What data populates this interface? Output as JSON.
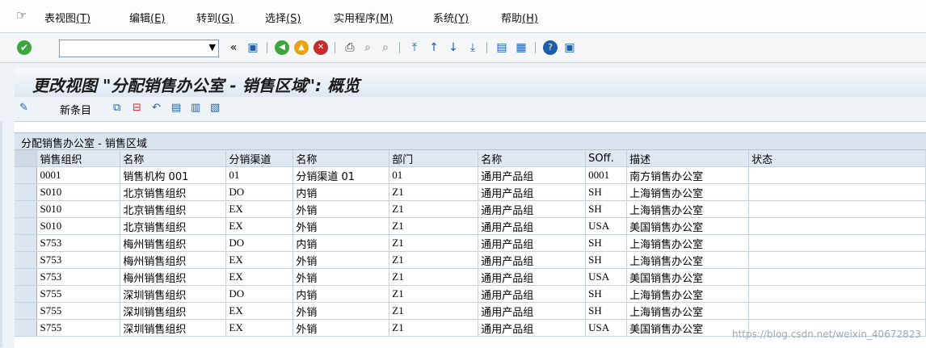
{
  "menubar": {
    "items": [
      {
        "label": "表视图",
        "acc": "(T)"
      },
      {
        "label": "编辑",
        "acc": "(E)"
      },
      {
        "label": "转到",
        "acc": "(G)"
      },
      {
        "label": "选择",
        "acc": "(S)"
      },
      {
        "label": "实用程序",
        "acc": "(M)"
      },
      {
        "label": "系统",
        "acc": "(Y)"
      },
      {
        "label": "帮助",
        "acc": "(H)"
      }
    ]
  },
  "toolbar": {
    "command_value": ""
  },
  "header": {
    "title": "更改视图 \"分配销售办公室 - 销售区域\": 概览"
  },
  "apptoolbar": {
    "new_entries": "新条目"
  },
  "table": {
    "title": "分配销售办公室 - 销售区域",
    "columns": [
      "销售组织",
      "名称",
      "分销渠道",
      "名称",
      "部门",
      "名称",
      "SOff.",
      "描述",
      "状态"
    ],
    "rows": [
      [
        "0001",
        "销售机构 001",
        "01",
        "分销渠道 01",
        "01",
        "通用产品组",
        "0001",
        "南方销售办公室",
        ""
      ],
      [
        "S010",
        "北京销售组织",
        "DO",
        "内销",
        "Z1",
        "通用产品组",
        "SH",
        "上海销售办公室",
        ""
      ],
      [
        "S010",
        "北京销售组织",
        "EX",
        "外销",
        "Z1",
        "通用产品组",
        "SH",
        "上海销售办公室",
        ""
      ],
      [
        "S010",
        "北京销售组织",
        "EX",
        "外销",
        "Z1",
        "通用产品组",
        "USA",
        "美国销售办公室",
        ""
      ],
      [
        "S753",
        "梅州销售组织",
        "DO",
        "内销",
        "Z1",
        "通用产品组",
        "SH",
        "上海销售办公室",
        ""
      ],
      [
        "S753",
        "梅州销售组织",
        "EX",
        "外销",
        "Z1",
        "通用产品组",
        "SH",
        "上海销售办公室",
        ""
      ],
      [
        "S753",
        "梅州销售组织",
        "EX",
        "外销",
        "Z1",
        "通用产品组",
        "USA",
        "美国销售办公室",
        ""
      ],
      [
        "S755",
        "深圳销售组织",
        "DO",
        "内销",
        "Z1",
        "通用产品组",
        "SH",
        "上海销售办公室",
        ""
      ],
      [
        "S755",
        "深圳销售组织",
        "EX",
        "外销",
        "Z1",
        "通用产品组",
        "SH",
        "上海销售办公室",
        ""
      ],
      [
        "S755",
        "深圳销售组织",
        "EX",
        "外销",
        "Z1",
        "通用产品组",
        "USA",
        "美国销售办公室",
        ""
      ]
    ]
  },
  "watermark": "https://blog.csdn.net/weixin_40672823",
  "colors": {
    "accent": "#1f5fa8",
    "ok": "#3ca63c",
    "grid_header": "#dfe8f1"
  }
}
